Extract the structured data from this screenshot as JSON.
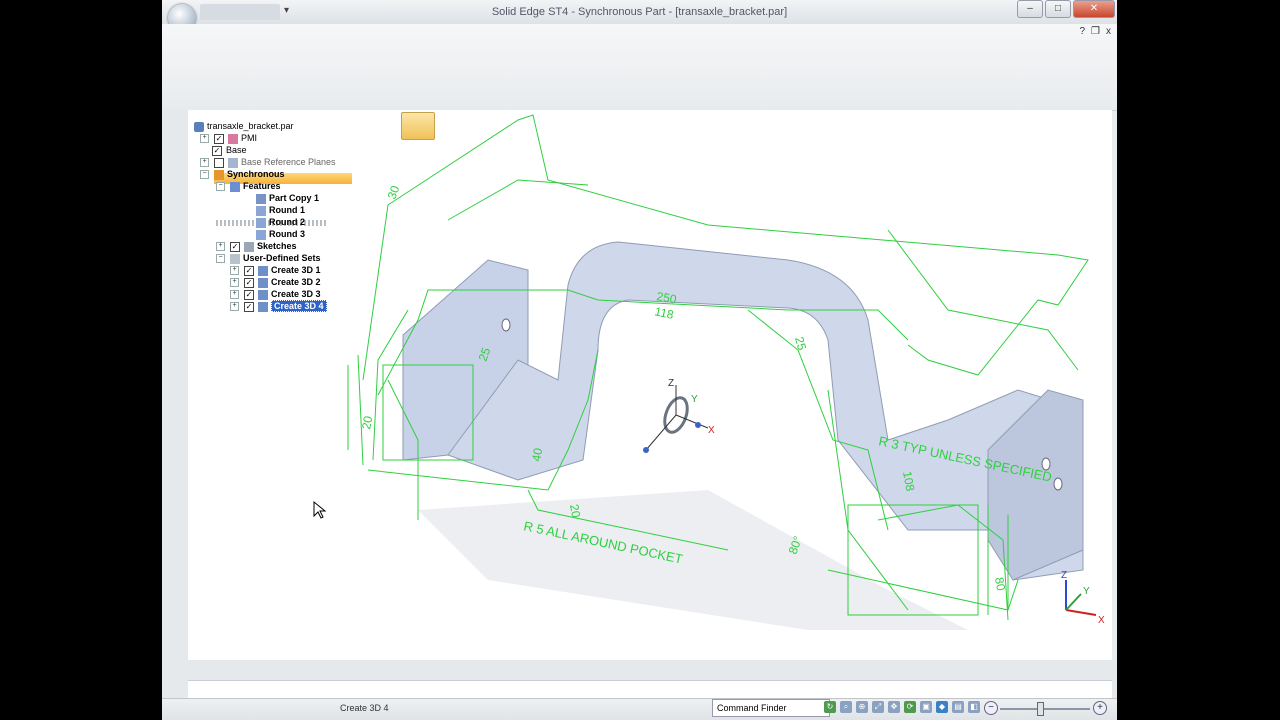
{
  "window": {
    "title": "Solid Edge ST4 - Synchronous Part - [transaxle_bracket.par]",
    "minimize_glyph": "–",
    "maximize_glyph": "□",
    "close_glyph": "✕"
  },
  "ribbon": {
    "help_glyph": "?",
    "restore_glyph": "❐",
    "close_glyph": "x"
  },
  "pathfinder": {
    "root": "transaxle_bracket.par",
    "items": [
      {
        "label": "PMI",
        "expander": "+",
        "checked": "✓",
        "icon": "pmi-icon"
      },
      {
        "label": "Base",
        "expander": "",
        "checked": "✓",
        "icon": "none"
      },
      {
        "label": "Base Reference Planes",
        "expander": "+",
        "checked": "",
        "icon": "planes-icon"
      },
      {
        "label": "Synchronous",
        "expander": "−",
        "checked": "",
        "icon": "synchronous-icon"
      },
      {
        "label": "Features",
        "expander": "−",
        "checked": "",
        "icon": "features-icon"
      },
      {
        "label": "Part Copy 1",
        "icon": "part-copy-icon"
      },
      {
        "label": "Round 1",
        "icon": "round-icon"
      },
      {
        "label": "Round 2",
        "icon": "round-icon"
      },
      {
        "label": "Round 3",
        "icon": "round-icon"
      },
      {
        "label": "Sketches",
        "expander": "+",
        "checked": "✓",
        "icon": "sketch-icon"
      },
      {
        "label": "User-Defined Sets",
        "expander": "−",
        "checked": "",
        "icon": "set-icon"
      },
      {
        "label": "Create 3D 1",
        "expander": "+",
        "checked": "✓",
        "icon": "create3d-icon"
      },
      {
        "label": "Create 3D 2",
        "expander": "+",
        "checked": "✓",
        "icon": "create3d-icon"
      },
      {
        "label": "Create 3D 3",
        "expander": "+",
        "checked": "✓",
        "icon": "create3d-icon"
      },
      {
        "label": "Create 3D 4",
        "expander": "+",
        "checked": "✓",
        "icon": "create3d-icon",
        "selected": true
      }
    ]
  },
  "model": {
    "dimensions": [
      "250",
      "118",
      "25",
      "25",
      "40",
      "20",
      "80°",
      "108",
      "80",
      "20",
      "30"
    ],
    "annotations": [
      "R 5  ALL AROUND POCKET",
      "R 3  TYP UNLESS SPECIFIED"
    ],
    "triad_labels": {
      "x": "X",
      "y": "Y",
      "z": "Z"
    },
    "colors": {
      "wire": "#2fcf3f",
      "body": "#c7d2e8",
      "body_dark": "#8f9cb4"
    }
  },
  "status": {
    "prompt": "Create 3D 4",
    "command_finder": "Command Finder",
    "zoom_minus": "−",
    "zoom_plus": "+",
    "icons": [
      "refresh-icon",
      "zoom-area-icon",
      "zoom-icon",
      "fit-icon",
      "pan-icon",
      "rotate-icon",
      "view-icon",
      "style-icon",
      "display-icon",
      "clip-icon"
    ]
  }
}
